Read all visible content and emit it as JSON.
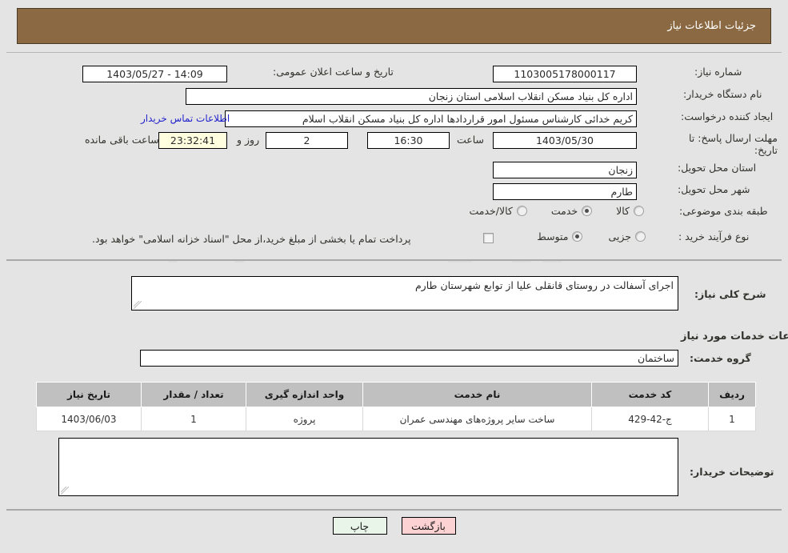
{
  "header": {
    "title": "جزئیات اطلاعات نیاز"
  },
  "fields": {
    "need_no_label": "شماره نیاز:",
    "need_no_value": "1103005178000117",
    "announce_label": "تاریخ و ساعت اعلان عمومی:",
    "announce_value": "14:09 - 1403/05/27",
    "buyer_org_label": "نام دستگاه خریدار:",
    "buyer_org_value": "اداره کل بنیاد مسکن انقلاب اسلامی استان زنجان",
    "requester_label": "ایجاد کننده درخواست:",
    "requester_value": "کریم خدائی کارشناس مسئول امور قراردادها اداره کل بنیاد مسکن انقلاب اسلام",
    "contact_link": "اطلاعات تماس خریدار",
    "deadline_label": "مهلت ارسال پاسخ: تا تاریخ:",
    "deadline_date": "1403/05/30",
    "hour_label": "ساعت",
    "hour_value": "16:30",
    "days_value": "2",
    "days_label": "روز و",
    "countdown_value": "23:32:41",
    "countdown_label": "ساعت باقی مانده",
    "province_label": "استان محل تحویل:",
    "province_value": "زنجان",
    "city_label": "شهر محل تحویل:",
    "city_value": "طارم",
    "category_label": "طبقه بندی موضوعی:",
    "process_label": "نوع فرآیند خرید :",
    "treasury_note": "پرداخت تمام یا بخشی از مبلغ خرید،از محل \"اسناد خزانه اسلامی\" خواهد بود."
  },
  "category_options": [
    {
      "label": "کالا",
      "selected": false
    },
    {
      "label": "خدمت",
      "selected": true
    },
    {
      "label": "کالا/خدمت",
      "selected": false
    }
  ],
  "process_options": [
    {
      "label": "جزیی",
      "selected": true
    },
    {
      "label": "متوسط",
      "selected": false
    }
  ],
  "description": {
    "label": "شرح کلی نیاز:",
    "value": "اجرای آسفالت در روستای قانقلی علیا از توابع شهرستان طارم"
  },
  "services_section": {
    "heading": "اطلاعات خدمات مورد نیاز",
    "group_label": "گروه خدمت:",
    "group_value": "ساختمان"
  },
  "table": {
    "columns": [
      "ردیف",
      "کد خدمت",
      "نام خدمت",
      "واحد اندازه گیری",
      "تعداد / مقدار",
      "تاریخ نیاز"
    ],
    "rows": [
      {
        "radif": "1",
        "code": "ج-42-429",
        "name": "ساخت سایر پروژه‌های مهندسی عمران",
        "unit": "پروژه",
        "qty": "1",
        "date": "1403/06/03"
      }
    ]
  },
  "buyer_notes": {
    "label": "توضیحات خریدار:",
    "value": ""
  },
  "buttons": {
    "print": "چاپ",
    "back": "بازگشت"
  },
  "colors": {
    "header_bar": "#8b6a43",
    "page_bg": "#e4e4e4",
    "link": "#2222cc",
    "countdown_bg": "#ffffe0",
    "table_header": "#c0c0c0",
    "print_btn": "#e9f5e9",
    "back_btn": "#fcd2d2"
  }
}
